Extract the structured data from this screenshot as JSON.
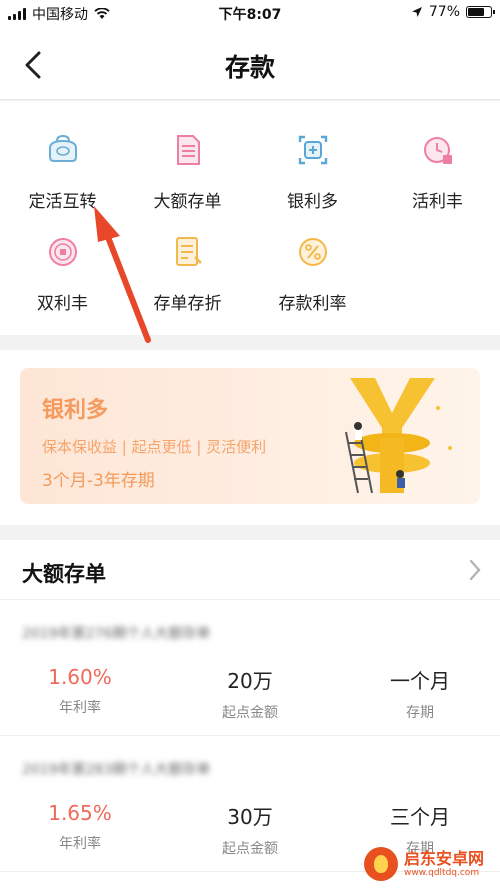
{
  "status_bar": {
    "carrier": "中国移动",
    "time": "下午8:07",
    "battery": "77%"
  },
  "nav": {
    "title": "存款"
  },
  "menu": {
    "items": [
      {
        "label": "定活互转",
        "icon": "deposit-transfer-icon"
      },
      {
        "label": "大额存单",
        "icon": "document-icon"
      },
      {
        "label": "银利多",
        "icon": "bank-card-icon"
      },
      {
        "label": "活利丰",
        "icon": "clock-icon"
      },
      {
        "label": "双利丰",
        "icon": "coin-icon"
      },
      {
        "label": "存单存折",
        "icon": "passbook-icon"
      },
      {
        "label": "存款利率",
        "icon": "percent-icon"
      }
    ]
  },
  "banner": {
    "title": "银利多",
    "subtitle": "保本保收益 | 起点更低 | 灵活便利",
    "term": "3个月-3年存期"
  },
  "large_deposit": {
    "title": "大额存单",
    "products": [
      {
        "name": "2019年第276期个人大额存单",
        "rate": "1.60%",
        "rate_label": "年利率",
        "min_amount": "20万",
        "min_label": "起点金额",
        "term": "一个月",
        "term_label": "存期"
      },
      {
        "name": "2019年第283期个人大额存单",
        "rate": "1.65%",
        "rate_label": "年利率",
        "min_amount": "30万",
        "min_label": "起点金额",
        "term": "三个月",
        "term_label": "存期"
      }
    ]
  },
  "watermark": {
    "name": "启东安卓网",
    "url": "www.qdltdq.com"
  },
  "colors": {
    "accent_rate": "#f0695a",
    "banner_text": "#f59a5f",
    "arrow": "#e8472a"
  }
}
